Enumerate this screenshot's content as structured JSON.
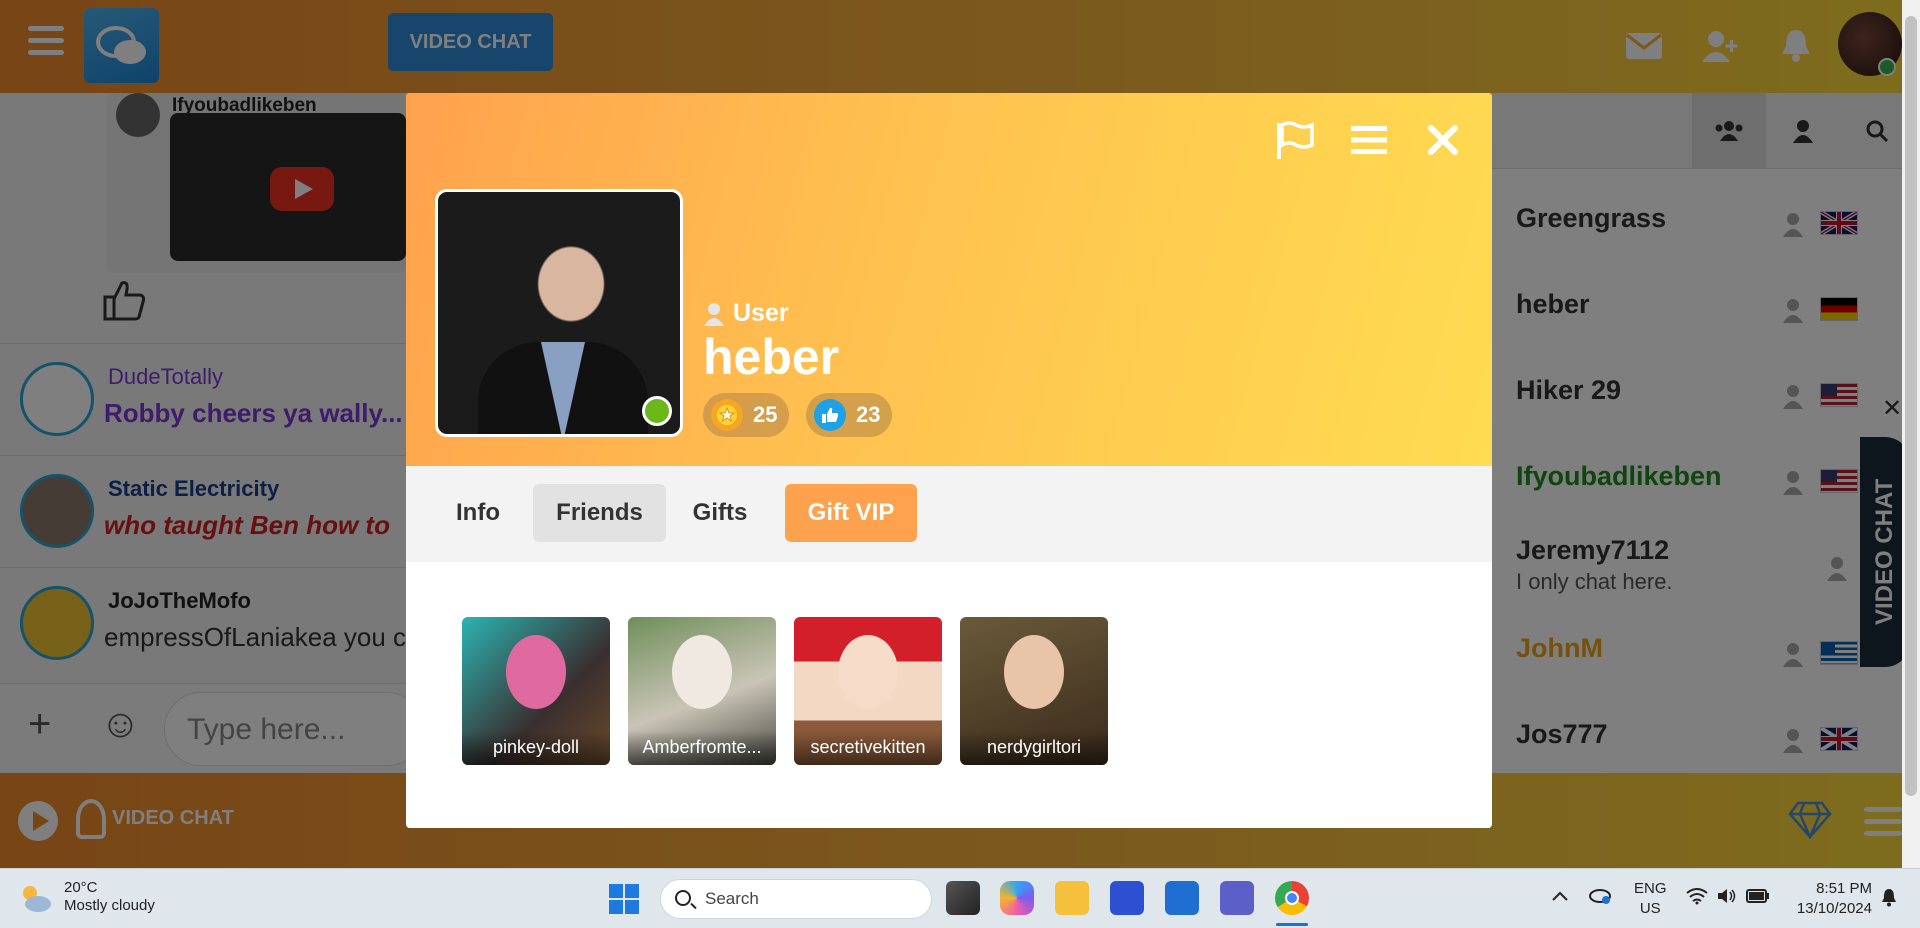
{
  "topbar": {
    "video_chat_label": "VIDEO CHAT"
  },
  "chat": {
    "post_author": "Ifyoubadlikeben",
    "messages": [
      {
        "name": "DudeTotally",
        "text": "Robby cheers ya wally...",
        "name_color": "#7b3bd6",
        "text_color": "#7b3bd6"
      },
      {
        "name": "Static Electricity",
        "text": "who taught Ben how to",
        "name_color": "#1d3e8a",
        "text_color": "#d02020"
      },
      {
        "name": "JoJoTheMofo",
        "text": "empressOfLaniakea you c",
        "name_color": "#222222",
        "text_color": "#333333"
      }
    ],
    "composer_placeholder": "Type here..."
  },
  "userlist": {
    "users": [
      {
        "name": "Greengrass",
        "mood": "",
        "color": "#333333",
        "flag": "gb"
      },
      {
        "name": "heber",
        "mood": "",
        "color": "#333333",
        "flag": "de"
      },
      {
        "name": "Hiker 29",
        "mood": "",
        "color": "#333333",
        "flag": "us"
      },
      {
        "name": "Ifyoubadlikeben",
        "mood": "",
        "color": "#1e8a1e",
        "flag": "us"
      },
      {
        "name": "Jeremy7112",
        "mood": "I only chat here.",
        "color": "#333333",
        "flag": ""
      },
      {
        "name": "JohnM",
        "mood": "",
        "color": "#e8a21a",
        "flag": "gr"
      },
      {
        "name": "Jos777",
        "mood": "",
        "color": "#333333",
        "flag": "gb"
      }
    ],
    "side_video_label": "VIDEO CHAT"
  },
  "footer": {
    "video_chat_label": "VIDEO CHAT"
  },
  "profile": {
    "role": "User",
    "username": "heber",
    "stars": "25",
    "likes": "23",
    "tabs": [
      {
        "label": "Info"
      },
      {
        "label": "Friends"
      },
      {
        "label": "Gifts"
      },
      {
        "label": "Gift VIP"
      }
    ],
    "active_tab": "Friends",
    "friends": [
      {
        "name": "pinkey-doll"
      },
      {
        "name": "Amberfromte..."
      },
      {
        "name": "secretivekitten"
      },
      {
        "name": "nerdygirltori"
      }
    ],
    "colors": {
      "header_start": "#ffa24e",
      "header_end": "#ffdc51",
      "vip": "#ffa24e",
      "online": "#6cb81b"
    }
  },
  "taskbar": {
    "temperature": "20°C",
    "weather": "Mostly cloudy",
    "search_placeholder": "Search",
    "lang_line1": "ENG",
    "lang_line2": "US",
    "time": "8:51 PM",
    "date": "13/10/2024"
  }
}
